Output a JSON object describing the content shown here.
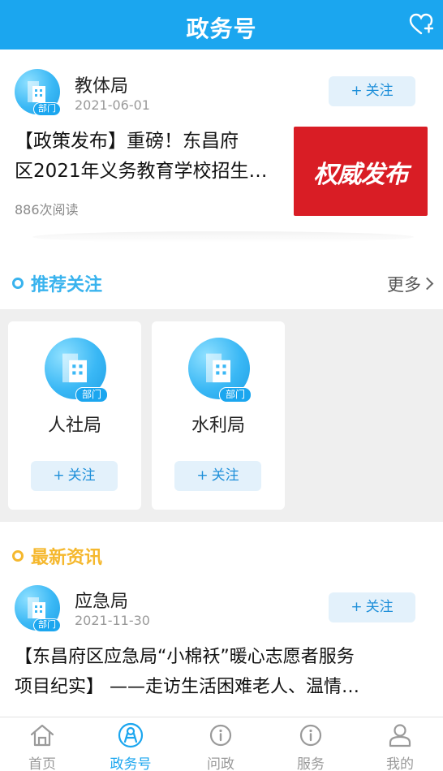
{
  "header": {
    "title": "政务号",
    "action_icon": "heart-plus-icon"
  },
  "feature": {
    "org_name": "教体局",
    "date": "2021-06-01",
    "follow_label": "关注",
    "headline_line1": "【政策发布】重磅！东昌府",
    "headline_line2": "区2021年义务教育学校招生…",
    "reads": "886次阅读",
    "thumb_text": "权威发布",
    "avatar_tag": "部门"
  },
  "recommend": {
    "title": "推荐关注",
    "more_label": "更多",
    "items": [
      {
        "name": "人社局",
        "follow_label": "关注",
        "avatar_tag": "部门"
      },
      {
        "name": "水利局",
        "follow_label": "关注",
        "avatar_tag": "部门"
      }
    ]
  },
  "latest": {
    "title": "最新资讯",
    "org_name": "应急局",
    "date": "2021-11-30",
    "follow_label": "关注",
    "avatar_tag": "部门",
    "headline_line1": "【东昌府区应急局“小棉袄”暖心志愿者服务",
    "headline_line2": "项目纪实】 ——走访生活困难老人、温情…"
  },
  "nav": {
    "items": [
      {
        "label": "首页",
        "icon": "home-icon",
        "active": false
      },
      {
        "label": "政务号",
        "icon": "gov-account-icon",
        "active": true
      },
      {
        "label": "问政",
        "icon": "info-icon",
        "active": false
      },
      {
        "label": "服务",
        "icon": "info-icon",
        "active": false
      },
      {
        "label": "我的",
        "icon": "user-icon",
        "active": false
      }
    ]
  },
  "colors": {
    "brand": "#1ba6ef",
    "recommend_accent": "#39b3ee",
    "latest_accent": "#f5b82e",
    "thumb_red": "#d91d25"
  }
}
